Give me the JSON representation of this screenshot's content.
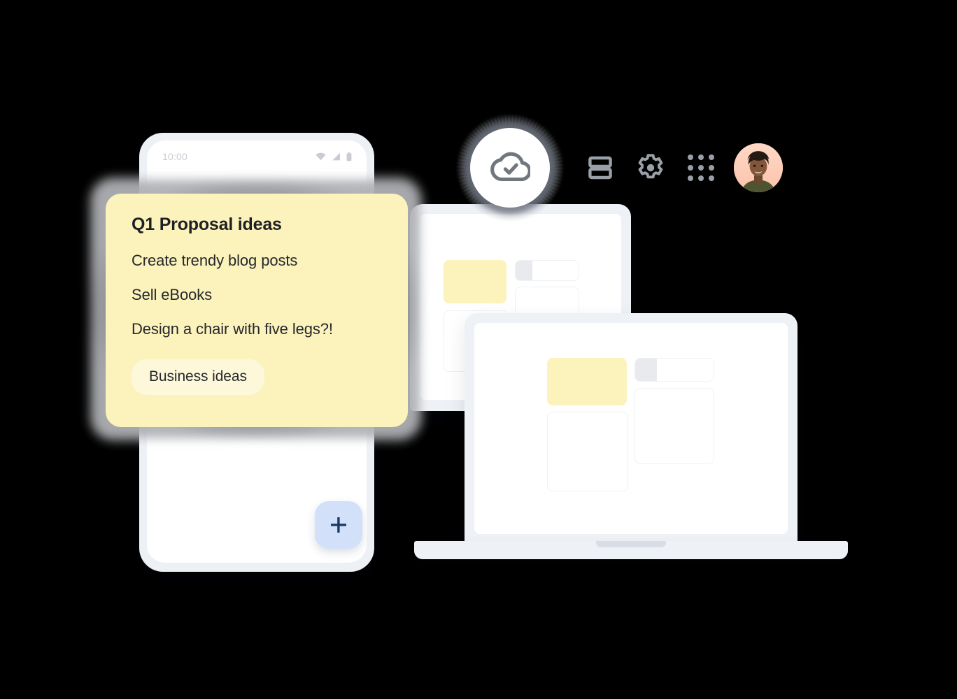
{
  "palette": {
    "background": "#000000",
    "note_yellow": "#FBF2BC",
    "chip_yellow": "#FDF8DA",
    "device_bezel": "#EEF1F6",
    "fab_blue": "#D2E0FA",
    "fab_plus": "#1B3A63",
    "icon_gray": "#9AA0A8",
    "card_border": "#F0F1F4",
    "note_shadow": "#8A8D93",
    "avatar_bg": "#FFD3C0"
  },
  "toolbar": {
    "cloud_badge": {
      "icon": "cloud-check-icon",
      "label": "Synced to cloud"
    },
    "items": [
      {
        "icon": "layout-rows-icon",
        "label": "Layout"
      },
      {
        "icon": "gear-icon",
        "label": "Settings"
      },
      {
        "icon": "apps-grid-icon",
        "label": "Apps"
      }
    ],
    "avatar": {
      "icon": "avatar",
      "label": "Account"
    }
  },
  "phone": {
    "status_bar": {
      "time": "10:00",
      "icons": [
        "wifi-icon",
        "signal-icon",
        "battery-icon"
      ]
    },
    "cards": [
      {
        "variant": "outline",
        "label": "note-card"
      },
      {
        "variant": "outline",
        "label": "note-card"
      }
    ],
    "fab": {
      "icon": "plus-icon",
      "label": "+"
    }
  },
  "note": {
    "title": "Q1 Proposal ideas",
    "lines": [
      "Create trendy blog posts",
      "Sell eBooks",
      "Design a chair with five legs?!"
    ],
    "chip": "Business ideas"
  },
  "laptops": [
    {
      "name": "laptop-back",
      "cards": [
        {
          "variant": "yellow",
          "label": "note-card-yellow"
        },
        {
          "variant": "outline",
          "label": "note-card"
        },
        {
          "variant": "pill",
          "label": "progress-card"
        },
        {
          "variant": "outline",
          "label": "note-card"
        }
      ]
    },
    {
      "name": "laptop-front",
      "cards": [
        {
          "variant": "yellow",
          "label": "note-card-yellow"
        },
        {
          "variant": "outline",
          "label": "note-card"
        },
        {
          "variant": "pill",
          "label": "progress-card"
        },
        {
          "variant": "outline",
          "label": "note-card"
        }
      ]
    }
  ]
}
